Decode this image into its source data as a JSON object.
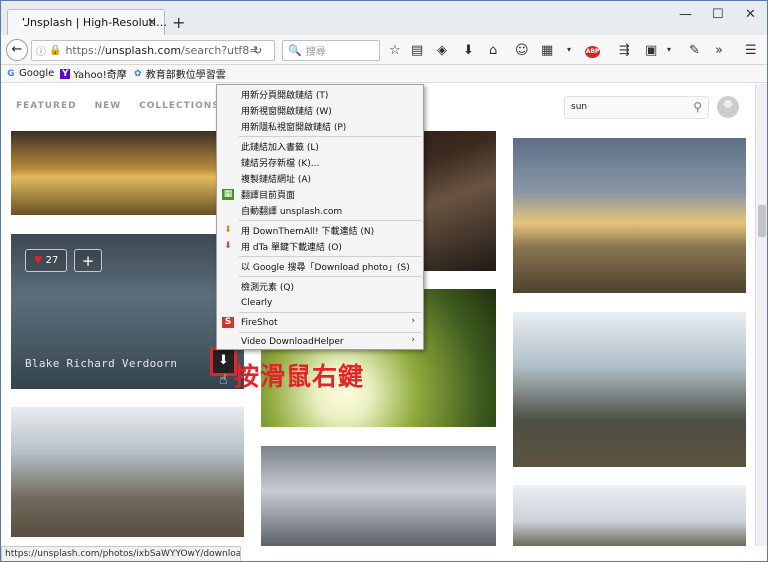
{
  "window": {
    "tab_title": "Unsplash | High-Resoluti…",
    "tab_close": "×",
    "new_tab": "+",
    "minimize": "—",
    "maximize": "☐",
    "close": "✕"
  },
  "navbar": {
    "url_prefix": "https://",
    "url_domain": "unsplash.com",
    "url_path": "/search?utf8=",
    "search_placeholder": "搜尋",
    "back_glyph": "←",
    "reload_glyph": "↻",
    "overflow_glyph": "»",
    "menu_glyph": "☰",
    "abp_label": "ABP"
  },
  "bookmarks": [
    {
      "label": "Google",
      "icon": "google-icon",
      "glyph": "G",
      "color": "#4285f4"
    },
    {
      "label": "Yahoo!奇摩",
      "icon": "yahoo-icon",
      "glyph": "Y",
      "color": "#5f01d1"
    },
    {
      "label": "教育部數位學習雲",
      "icon": "edu-icon",
      "glyph": "✿",
      "color": "#2a7fd4"
    }
  ],
  "page": {
    "nav": [
      "FEATURED",
      "NEW",
      "COLLECTIONS"
    ],
    "search_value": "sun",
    "like_count": "27",
    "add_glyph": "+",
    "photographer": "Blake Richard Verdoorn",
    "download_glyph": "⬇"
  },
  "context_menu": {
    "items": [
      {
        "label": "用新分頁開啟鏈結 (T)"
      },
      {
        "label": "用新視窗開啟鏈結 (W)"
      },
      {
        "label": "用新隱私視窗開啟鏈結 (P)"
      },
      {
        "label": "此鏈結加入書籤 (L)"
      },
      {
        "label": "鏈結另存新檔 (K)..."
      },
      {
        "label": "複製鏈結網址 (A)"
      },
      {
        "label": "翻譯目前頁面",
        "icon": "translate-icon"
      },
      {
        "label": "自動翻譯 unsplash.com"
      },
      {
        "label": "用 DownThemAll! 下載連結 (N)",
        "icon": "downthemall-icon"
      },
      {
        "label": "用 dTa 單鍵下載連結 (O)",
        "icon": "dta-icon"
      },
      {
        "label": "以 Google 搜尋「Download photo」(S)"
      },
      {
        "label": "檢測元素 (Q)"
      },
      {
        "label": "Clearly"
      },
      {
        "label": "FireShot",
        "icon": "fireshot-icon",
        "submenu": true
      },
      {
        "label": "Video DownloadHelper",
        "submenu": true
      }
    ],
    "submenu_glyph": "›"
  },
  "annotation": "按滑鼠右鍵",
  "status_url": "https://unsplash.com/photos/ixbSaWYYOwY/download",
  "colors": {
    "accent_red": "#e0262a",
    "like_heart": "#e0262a"
  }
}
